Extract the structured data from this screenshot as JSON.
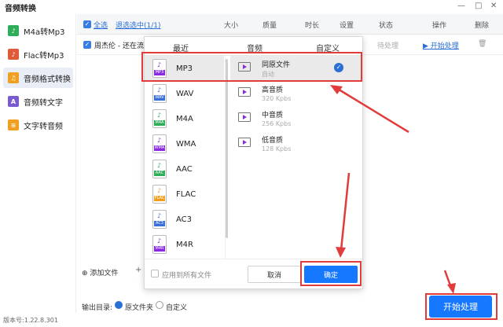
{
  "window": {
    "title": "音频转换",
    "min": "—",
    "max": "□",
    "close": "✕"
  },
  "sidebar": {
    "items": [
      {
        "label": "M4a转Mp3",
        "color": "#2eae5b",
        "icon": "music-file-icon"
      },
      {
        "label": "Flac转Mp3",
        "color": "#e05a3a",
        "icon": "music-file-icon"
      },
      {
        "label": "音频格式转换",
        "color": "#f0a020",
        "icon": "music-convert-icon"
      },
      {
        "label": "音频转文字",
        "color": "#7a5ccf",
        "icon": "text-icon"
      },
      {
        "label": "文字转音频",
        "color": "#f0a020",
        "icon": "audio-wave-icon"
      }
    ]
  },
  "table": {
    "select_all": "全选",
    "deselect": "退选选中(1/1)",
    "headers": [
      "大小",
      "质量",
      "时长",
      "设置",
      "状态",
      "操作",
      "删除"
    ],
    "rows": [
      {
        "name": "周杰伦 - 还在流浪",
        "status": "待处理",
        "action": "开始处理"
      }
    ]
  },
  "bottom": {
    "add_file": "添加文件",
    "add_folder": "+"
  },
  "output": {
    "label": "输出目录:",
    "opt_source": "原文件夹",
    "opt_custom": "自定义"
  },
  "statusbar": {
    "version": "版本号:1.22.8.301"
  },
  "start_button": "开始处理",
  "popup": {
    "tabs": [
      "最近",
      "音频",
      "自定义"
    ],
    "formats": [
      {
        "label": "MP3",
        "tag": "MP3",
        "color": "#8a2be2"
      },
      {
        "label": "WAV",
        "tag": "WAV",
        "color": "#3a6fd6"
      },
      {
        "label": "M4A",
        "tag": "M4A",
        "color": "#2eae5b"
      },
      {
        "label": "WMA",
        "tag": "WMA",
        "color": "#8a2be2"
      },
      {
        "label": "AAC",
        "tag": "AAC",
        "color": "#2eae5b"
      },
      {
        "label": "FLAC",
        "tag": "FLAC",
        "color": "#f0a020"
      },
      {
        "label": "AC3",
        "tag": "AC3",
        "color": "#3a6fd6"
      },
      {
        "label": "M4R",
        "tag": "M4R",
        "color": "#8a2be2"
      }
    ],
    "qualities": [
      {
        "name": "同原文件",
        "sub": "自动"
      },
      {
        "name": "高音质",
        "sub": "320 Kpbs"
      },
      {
        "name": "中音质",
        "sub": "256 Kpbs"
      },
      {
        "name": "低音质",
        "sub": "128 Kpbs"
      }
    ],
    "apply_all": "应用到所有文件",
    "cancel": "取消",
    "ok": "确定"
  },
  "colors": {
    "accent": "#1677ff",
    "highlight": "#e23b3b"
  }
}
